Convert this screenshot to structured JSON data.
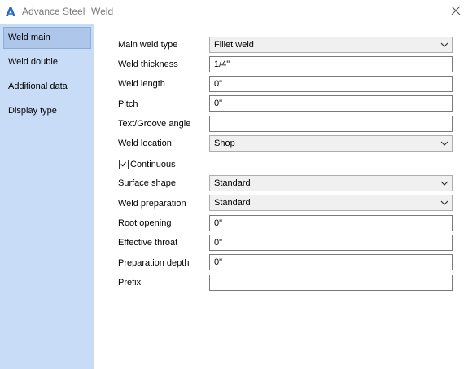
{
  "window": {
    "app_name": "Advance Steel",
    "dialog_name": "Weld"
  },
  "sidebar": {
    "items": [
      {
        "label": "Weld main",
        "selected": true
      },
      {
        "label": "Weld double",
        "selected": false
      },
      {
        "label": "Additional data",
        "selected": false
      },
      {
        "label": "Display type",
        "selected": false
      }
    ]
  },
  "form": {
    "main_weld_type": {
      "label": "Main weld type",
      "value": "Fillet weld"
    },
    "weld_thickness": {
      "label": "Weld thickness",
      "value": "1/4\""
    },
    "weld_length": {
      "label": "Weld length",
      "value": "0\""
    },
    "pitch": {
      "label": "Pitch",
      "value": "0\""
    },
    "text_groove_angle": {
      "label": "Text/Groove angle",
      "value": ""
    },
    "weld_location": {
      "label": "Weld location",
      "value": "Shop"
    },
    "continuous": {
      "label": "Continuous",
      "checked": true
    },
    "surface_shape": {
      "label": "Surface shape",
      "value": "Standard"
    },
    "weld_preparation": {
      "label": "Weld preparation",
      "value": "Standard"
    },
    "root_opening": {
      "label": "Root opening",
      "value": "0\""
    },
    "effective_throat": {
      "label": "Effective throat",
      "value": "0\""
    },
    "preparation_depth": {
      "label": "Preparation depth",
      "value": "0\""
    },
    "prefix": {
      "label": "Prefix",
      "value": ""
    }
  },
  "colors": {
    "sidebar_bg": "#c9dcf7",
    "selected_item_bg": "#aec6ea",
    "logo": "#2b6bbd"
  },
  "icons": {
    "app": "advance-steel-logo",
    "close": "close-icon",
    "dropdown": "chevron-down-icon",
    "check": "checkmark-icon"
  }
}
